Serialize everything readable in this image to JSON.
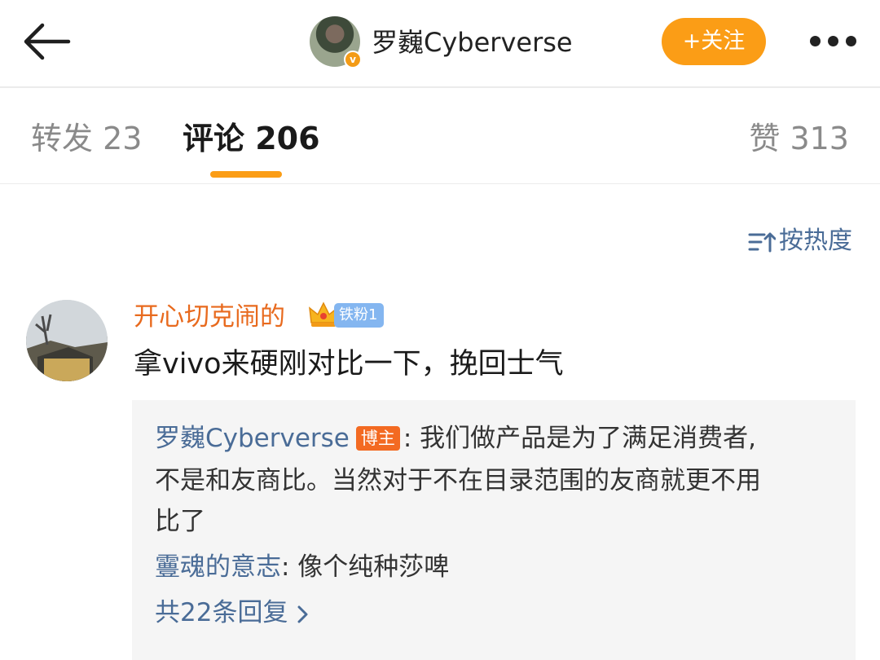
{
  "header": {
    "author_name": "罗巍Cyberverse",
    "follow_label": "+关注",
    "verified_mark": "v",
    "icons": [
      "arrow-left-icon",
      "verified-badge-icon",
      "more-dots-icon"
    ]
  },
  "tabs": {
    "repost": "转发 23",
    "comments": "评论 206",
    "likes": "赞 313"
  },
  "sort": {
    "label": "按热度",
    "icon": "sort-icon"
  },
  "comment": {
    "user": "开心切克闹的",
    "fan_badge": "铁粉1",
    "text": "拿vivo来硬刚对比一下，挽回士气",
    "icons": [
      "crown-icon"
    ]
  },
  "replies": {
    "items": [
      {
        "user": "罗巍Cyberverse",
        "badge": "博主",
        "line1": ": 我们做产品是为了满足消费者,",
        "line2": "不是和友商比。当然对于不在目录范围的友商就更不用",
        "line3": "比了"
      },
      {
        "user": "霻魂的意志",
        "text": ": 像个纯种莎啤"
      }
    ],
    "more_label": "共22条回复"
  },
  "colors": {
    "accent_orange": "#fb9d16",
    "link_blue": "#4a6c97",
    "commenter_orange": "#e86a1e",
    "fan_badge_blue": "#84b6f0",
    "host_badge": "#f36a22",
    "reply_bg": "#f5f5f5"
  }
}
